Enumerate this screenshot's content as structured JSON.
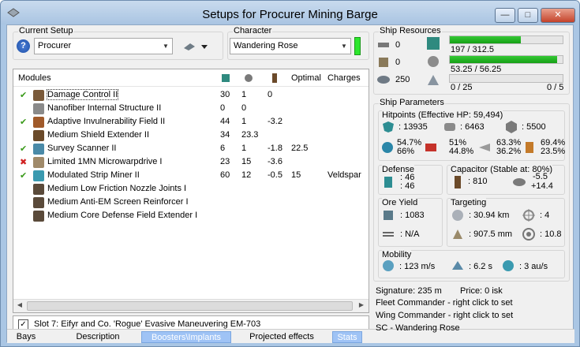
{
  "window": {
    "title": "Setups for Procurer Mining Barge"
  },
  "current_setup": {
    "label": "Current Setup",
    "value": "Procurer"
  },
  "character": {
    "label": "Character",
    "value": "Wandering Rose"
  },
  "modules": {
    "columns": [
      "Modules",
      "Optimal",
      "Charges"
    ],
    "rows": [
      {
        "status": "check",
        "name": "Damage Control II",
        "c1": "30",
        "c2": "1",
        "c3": "0",
        "optimal": "",
        "charges": ""
      },
      {
        "status": "",
        "name": "Nanofiber Internal Structure II",
        "c1": "0",
        "c2": "0",
        "c3": "",
        "optimal": "",
        "charges": ""
      },
      {
        "status": "check",
        "name": "Adaptive Invulnerability Field II",
        "c1": "44",
        "c2": "1",
        "c3": "-3.2",
        "optimal": "",
        "charges": ""
      },
      {
        "status": "",
        "name": "Medium Shield Extender II",
        "c1": "34",
        "c2": "23.3",
        "c3": "",
        "optimal": "",
        "charges": ""
      },
      {
        "status": "check",
        "name": "Survey Scanner II",
        "c1": "6",
        "c2": "1",
        "c3": "-1.8",
        "optimal": "22.5",
        "charges": ""
      },
      {
        "status": "cross",
        "name": "Limited 1MN Microwarpdrive I",
        "c1": "23",
        "c2": "15",
        "c3": "-3.6",
        "optimal": "",
        "charges": ""
      },
      {
        "status": "check",
        "name": "Modulated Strip Miner II",
        "c1": "60",
        "c2": "12",
        "c3": "-0.5",
        "optimal": "15",
        "charges": "Veldspar"
      },
      {
        "status": "",
        "name": "Medium Low Friction Nozzle Joints I",
        "c1": "",
        "c2": "",
        "c3": "",
        "optimal": "",
        "charges": ""
      },
      {
        "status": "",
        "name": "Medium Anti-EM Screen Reinforcer I",
        "c1": "",
        "c2": "",
        "c3": "",
        "optimal": "",
        "charges": ""
      },
      {
        "status": "",
        "name": "Medium Core Defense Field Extender I",
        "c1": "",
        "c2": "",
        "c3": "",
        "optimal": "",
        "charges": ""
      }
    ]
  },
  "slot": {
    "checked": true,
    "text": "Slot 7: Eifyr and Co. 'Rogue' Evasive Maneuvering EM-703"
  },
  "tabs": [
    "Bays",
    "Description",
    "Boosters\\Implants",
    "Projected effects",
    "Stats"
  ],
  "ship_resources": {
    "label": "Ship Resources",
    "hardpoints": [
      "0",
      "0",
      "250"
    ],
    "cpu": {
      "text": "197 / 312.5",
      "fill": 0.63
    },
    "power": {
      "text": "53.25 / 56.25",
      "fill": 0.95
    },
    "calibration": {
      "left": "0 / 25",
      "right": "0 / 5"
    }
  },
  "ship_parameters": {
    "label": "Ship Parameters",
    "hitpoints_label": "Hitpoints (Effective HP: 59,494)",
    "hp": [
      ": 13935",
      ": 6463",
      ": 5500"
    ],
    "resists": [
      [
        "54.7%",
        "66%"
      ],
      [
        "51%",
        "44.8%"
      ],
      [
        "63.3%",
        "36.2%"
      ],
      [
        "69.4%",
        "23.5%"
      ]
    ],
    "defense_label": "Defense",
    "defense": [
      ": 46",
      ": 46"
    ],
    "capacitor_label": "Capacitor (Stable at: 80%)",
    "capacitor": {
      "amount": ": 810",
      "delta1": "-5.5",
      "delta2": "+14.4"
    },
    "ore_label": "Ore Yield",
    "ore": [
      ": 1083",
      ": N/A"
    ],
    "targeting_label": "Targeting",
    "targeting": [
      ": 30.94 km",
      ": 4",
      ": 907.5 mm",
      ": 10.8"
    ],
    "mobility_label": "Mobility",
    "mobility": [
      ": 123 m/s",
      ": 6.2 s",
      ": 3 au/s"
    ]
  },
  "footer": {
    "signature": "Signature: 235 m",
    "price": "Price: 0 isk",
    "fleet": "Fleet Commander - right click to set",
    "wing": "Wing Commander - right click to set",
    "sc": "SC - Wandering Rose"
  }
}
